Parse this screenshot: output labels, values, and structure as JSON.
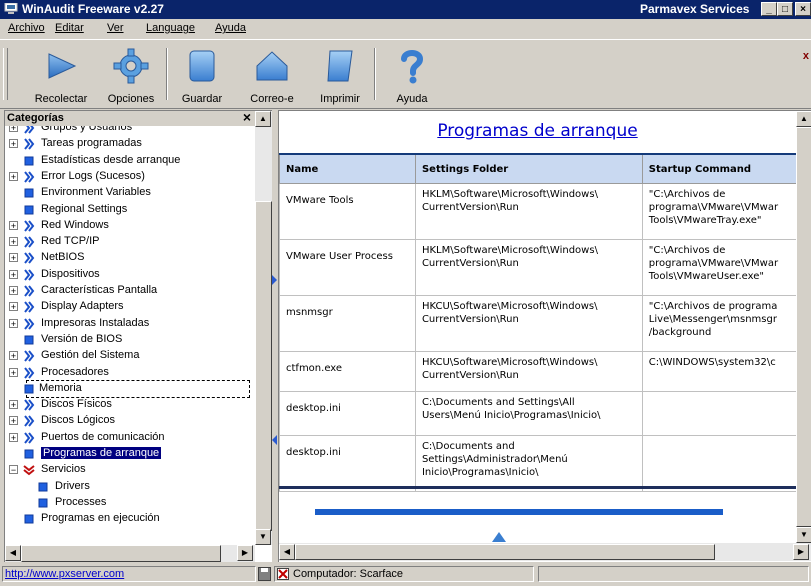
{
  "window": {
    "title": "WinAudit Freeware v2.27",
    "company": "Parmavex Services",
    "controls": [
      "_",
      "□",
      "×"
    ]
  },
  "menu": [
    "Archivo",
    "Editar",
    "Ver",
    "Language",
    "Ayuda"
  ],
  "toolbar": {
    "buttons": [
      {
        "label": "Recolectar",
        "icon": "play-arrow-icon"
      },
      {
        "label": "Opciones",
        "icon": "gear-icon"
      },
      {
        "label": "Guardar",
        "icon": "save-disk-icon"
      },
      {
        "label": "Correo-e",
        "icon": "email-envelope-icon"
      },
      {
        "label": "Imprimir",
        "icon": "print-scroll-icon"
      },
      {
        "label": "Ayuda",
        "icon": "question-mark-icon"
      }
    ],
    "close_glyph": "x"
  },
  "categories": {
    "title": "Categorías",
    "close": "×",
    "items": [
      {
        "label": "Grupos y Usuarios",
        "expandable": true,
        "type": "group"
      },
      {
        "label": "Tareas programadas",
        "expandable": true,
        "type": "group"
      },
      {
        "label": "Estadísticas desde arranque",
        "expandable": false,
        "type": "leaf"
      },
      {
        "label": "Error Logs (Sucesos)",
        "expandable": true,
        "type": "group"
      },
      {
        "label": "Environment Variables",
        "expandable": false,
        "type": "leaf"
      },
      {
        "label": "Regional Settings",
        "expandable": false,
        "type": "leaf"
      },
      {
        "label": "Red Windows",
        "expandable": true,
        "type": "group"
      },
      {
        "label": "Red TCP/IP",
        "expandable": true,
        "type": "group"
      },
      {
        "label": "NetBIOS",
        "expandable": true,
        "type": "group"
      },
      {
        "label": "Dispositivos",
        "expandable": true,
        "type": "group"
      },
      {
        "label": "Características Pantalla",
        "expandable": true,
        "type": "group"
      },
      {
        "label": "Display Adapters",
        "expandable": true,
        "type": "group"
      },
      {
        "label": "Impresoras Instaladas",
        "expandable": true,
        "type": "group"
      },
      {
        "label": "Versión de BIOS",
        "expandable": false,
        "type": "leaf"
      },
      {
        "label": "Gestión del Sistema",
        "expandable": true,
        "type": "group"
      },
      {
        "label": "Procesadores",
        "expandable": true,
        "type": "group"
      },
      {
        "label": "Memoria",
        "expandable": false,
        "type": "leaf",
        "focused": true
      },
      {
        "label": "Discos Físicos",
        "expandable": true,
        "type": "group"
      },
      {
        "label": "Discos Lógicos",
        "expandable": true,
        "type": "group"
      },
      {
        "label": "Puertos de comunicación",
        "expandable": true,
        "type": "group"
      },
      {
        "label": "Programas de arranque",
        "expandable": false,
        "type": "leaf",
        "selected": true
      },
      {
        "label": "Servicios",
        "expandable": true,
        "expanded": true,
        "type": "group"
      },
      {
        "label": "Drivers",
        "expandable": false,
        "type": "leaf",
        "indent": 1
      },
      {
        "label": "Processes",
        "expandable": false,
        "type": "leaf",
        "indent": 1
      },
      {
        "label": "Programas en ejecución",
        "expandable": false,
        "type": "leaf"
      }
    ]
  },
  "report": {
    "heading": "Programas de arranque",
    "columns": [
      "Name",
      "Settings Folder",
      "Startup Command"
    ],
    "rows": [
      [
        "VMware Tools",
        "HKLM\\Software\\Microsoft\\Windows\\ CurrentVersion\\Run",
        "\"C:\\Archivos de programa\\VMware\\VMwar Tools\\VMwareTray.exe\""
      ],
      [
        "VMware User Process",
        "HKLM\\Software\\Microsoft\\Windows\\ CurrentVersion\\Run",
        "\"C:\\Archivos de programa\\VMware\\VMwar Tools\\VMwareUser.exe\""
      ],
      [
        "msnmsgr",
        "HKCU\\Software\\Microsoft\\Windows\\ CurrentVersion\\Run",
        "\"C:\\Archivos de programa Live\\Messenger\\msnmsgr /background"
      ],
      [
        "ctfmon.exe",
        "HKCU\\Software\\Microsoft\\Windows\\ CurrentVersion\\Run",
        "C:\\WINDOWS\\system32\\c"
      ],
      [
        "desktop.ini",
        "C:\\Documents and Settings\\All Users\\Menú Inicio\\Programas\\Inicio\\",
        ""
      ],
      [
        "desktop.ini",
        "C:\\Documents and Settings\\Administrador\\Menú Inicio\\Programas\\Inicio\\",
        ""
      ]
    ]
  },
  "status": {
    "link": "http://www.pxserver.com",
    "computer": "Computador: Scarface"
  },
  "colors": {
    "titlebar": "#0a246a",
    "selection": "#000080",
    "header_fill": "#c9d9f1",
    "link": "#0000cc"
  }
}
